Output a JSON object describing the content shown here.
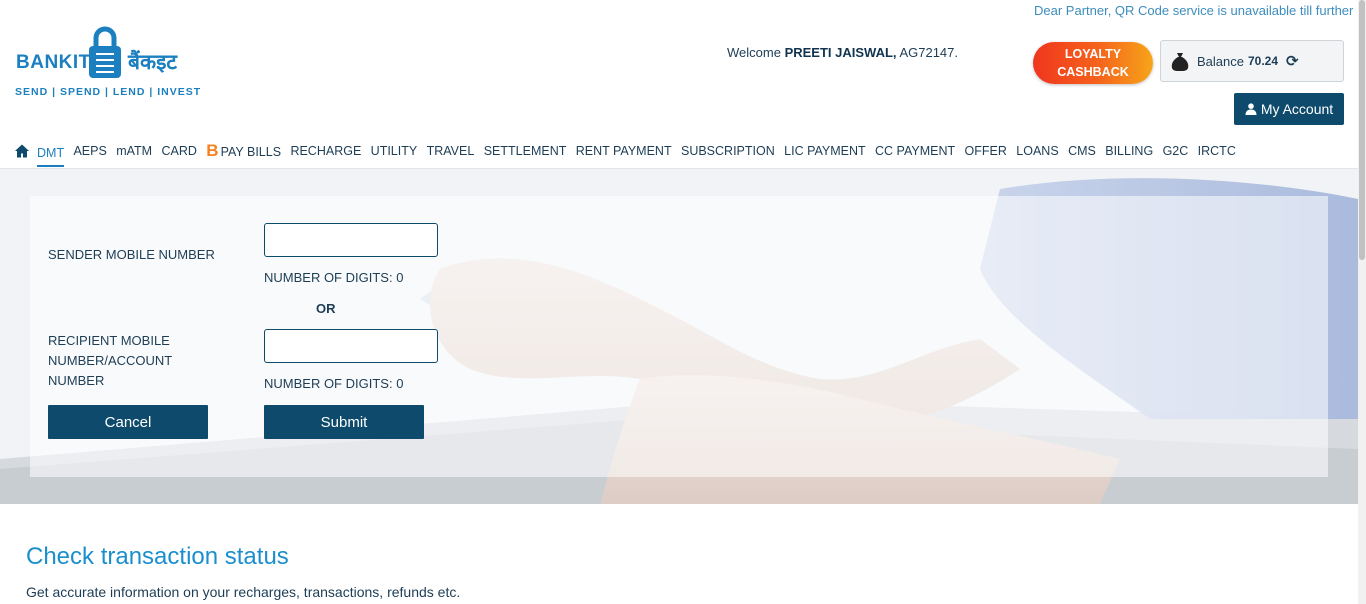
{
  "notice": "Dear Partner, QR Code service is unavailable till further n",
  "brand": {
    "name_en": "BANKIT",
    "name_hi": "बैंकइट",
    "tagline": "SEND | SPEND | LEND | INVEST",
    "color": "#1b7fc0"
  },
  "header": {
    "welcome_prefix": "Welcome",
    "user_name": "PREETI JAISWAL,",
    "agent_id": "AG72147.",
    "loyalty_line1": "LOYALTY",
    "loyalty_line2": "CASHBACK",
    "balance_label": "Balance",
    "balance_value": "70.24",
    "account_label": "My Account"
  },
  "nav": {
    "items": [
      "DMT",
      "AEPS",
      "mATM",
      "CARD",
      "PAY BILLS",
      "RECHARGE",
      "UTILITY",
      "TRAVEL",
      "SETTLEMENT",
      "RENT PAYMENT",
      "SUBSCRIPTION",
      "LIC PAYMENT",
      "CC PAYMENT",
      "OFFER",
      "LOANS",
      "CMS",
      "BILLING",
      "G2C",
      "IRCTC"
    ],
    "active": "DMT",
    "bbps_glyph": "B"
  },
  "form": {
    "sender_label": "SENDER MOBILE NUMBER",
    "sender_value": "",
    "sender_digits_label": "NUMBER OF DIGITS:",
    "sender_digits": "0",
    "or_label": "OR",
    "recipient_label_1": "RECIPIENT MOBILE",
    "recipient_label_2": "NUMBER/ACCOUNT",
    "recipient_label_3": "NUMBER",
    "recipient_value": "",
    "recipient_digits_label": "NUMBER OF DIGITS:",
    "recipient_digits": "0",
    "cancel_label": "Cancel",
    "submit_label": "Submit"
  },
  "status": {
    "title": "Check transaction status",
    "description": "Get accurate information on your recharges, transactions, refunds etc."
  },
  "colors": {
    "primary_dark": "#0d4a6b",
    "accent_blue": "#1b8fce",
    "loyalty_orange": "#f5641c"
  },
  "icons": {
    "home": "home-icon",
    "bbps": "bbps-icon",
    "money_bag": "money-bag-icon",
    "refresh": "refresh-icon",
    "user": "user-icon",
    "lock": "lock-logo-icon"
  }
}
